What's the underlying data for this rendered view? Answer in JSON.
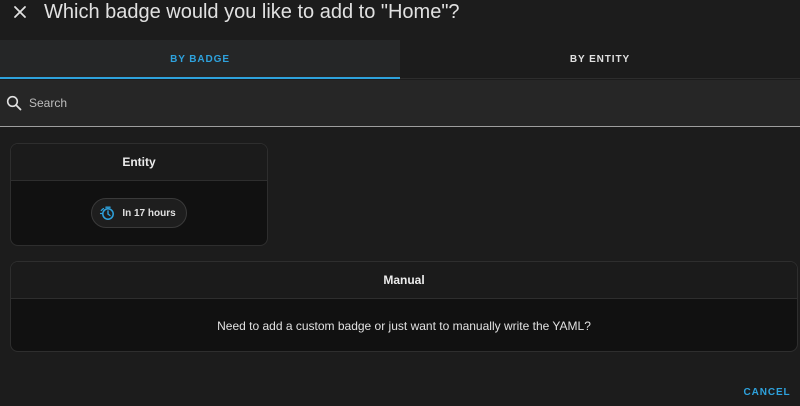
{
  "dialog": {
    "title": "Which badge would you like to add to \"Home\"?",
    "close_icon": "close-icon"
  },
  "tabs": [
    {
      "label": "BY BADGE",
      "active": true
    },
    {
      "label": "BY ENTITY",
      "active": false
    }
  ],
  "search": {
    "placeholder": "Search",
    "value": "",
    "icon": "search-icon"
  },
  "cards": {
    "entity": {
      "title": "Entity",
      "badge": {
        "icon": "timer-bell-icon",
        "text": "In 17 hours"
      }
    },
    "manual": {
      "title": "Manual",
      "description": "Need to add a custom badge or just want to manually write the YAML?"
    }
  },
  "footer": {
    "cancel_label": "CANCEL"
  },
  "colors": {
    "background": "#1c1c1c",
    "accent": "#2ea2dd",
    "card": "#111111",
    "text": "#e1e1e1"
  }
}
